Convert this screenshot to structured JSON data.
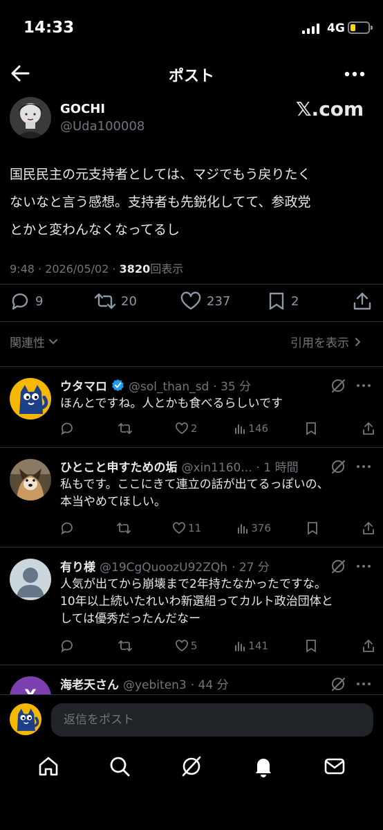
{
  "status_bar": {
    "time": "14:33",
    "network": "4G"
  },
  "header": {
    "title": "ポスト"
  },
  "post": {
    "author_name": "GOCHI",
    "author_handle": "@Uda100008",
    "brand": "𝕏.com",
    "lines": [
      "国民民主の元支持者としては、マジでもう戻りたく",
      "ないなと言う感想。支持者も先鋭化してて、参政党",
      "とかと変わんなくなってるし"
    ],
    "time": "9:48 · 2026/05/02 · ",
    "views_count": "3820",
    "views_label": "回表示",
    "replies": "9",
    "reposts": "20",
    "likes": "237",
    "bookmarks": "2"
  },
  "filters": {
    "sort": "関連性",
    "quotes": "引用を表示"
  },
  "replies": [
    {
      "name": "ウタマロ",
      "handle": "@sol_than_sd",
      "time": "· 35 分",
      "lines": [
        "ほんとですね。人とかも食べるらしいです"
      ],
      "replies": "",
      "reposts": "",
      "likes": "2",
      "views": "146",
      "verified": true
    },
    {
      "name": "ひとこと申すための垢",
      "handle": "@xin1160...",
      "time": "· 1 時間",
      "lines": [
        "私もです。ここにきて連立の話が出てるっぽいの、",
        "本当やめてほしい。"
      ],
      "replies": "",
      "reposts": "",
      "likes": "11",
      "views": "376"
    },
    {
      "name": "有り様",
      "handle": "@19CgQuoozU92ZQh",
      "time": "· 27 分",
      "lines": [
        "人気が出てから崩壊まで2年持たなかったですな。",
        "10年以上続いたれいわ新選組ってカルト政治団体と",
        "しては優秀だったんだなー"
      ],
      "replies": "",
      "reposts": "",
      "likes": "5",
      "views": "141"
    },
    {
      "name": "海老天さん",
      "handle": "@yebiten3",
      "time": "· 44 分",
      "avatar_letter": "Y"
    }
  ],
  "compose": {
    "placeholder": "返信をポスト"
  },
  "colors": {
    "background": "#000000",
    "accent": "#1d9bf0",
    "muted": "#71767b",
    "battery": "#ffd60a",
    "avatar_cat": "#f5b800"
  }
}
